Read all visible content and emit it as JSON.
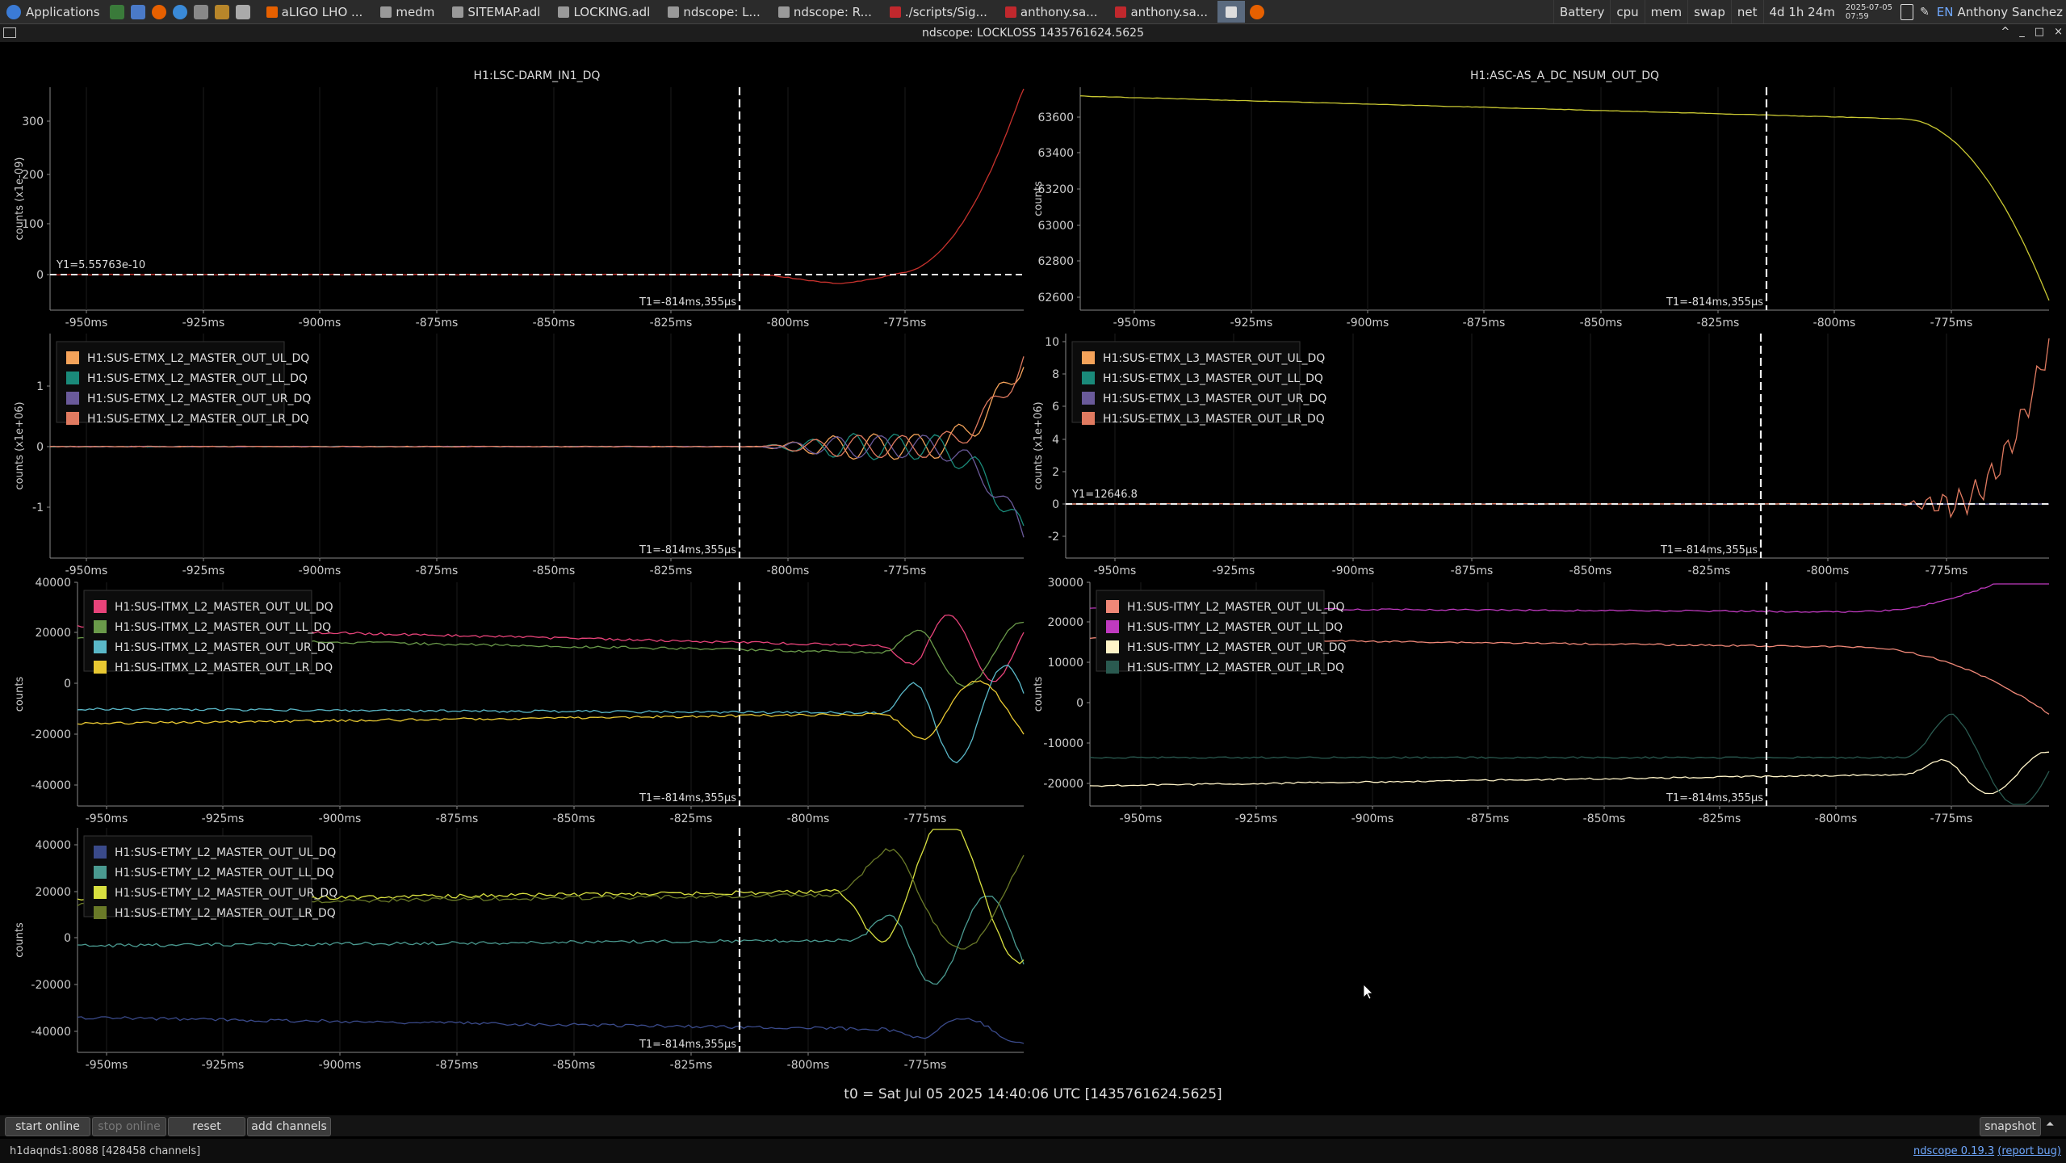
{
  "taskbar": {
    "applications_label": "Applications",
    "tasks": [
      {
        "label": "aLIGO LHO ...",
        "color": "#e66000"
      },
      {
        "label": "medm",
        "color": "#999999"
      },
      {
        "label": "SITEMAP.adl",
        "color": "#999999"
      },
      {
        "label": "LOCKING.adl",
        "color": "#999999"
      },
      {
        "label": "ndscope: L...",
        "color": "#999999"
      },
      {
        "label": "ndscope: R...",
        "color": "#999999"
      },
      {
        "label": "./scripts/Sig...",
        "color": "#c0282d"
      },
      {
        "label": "anthony.sa...",
        "color": "#c0282d"
      },
      {
        "label": "anthony.sa...",
        "color": "#c0282d"
      }
    ],
    "tray": [
      "Battery",
      "cpu",
      "mem",
      "swap",
      "net"
    ],
    "uptime": "4d 1h 24m",
    "date": "2025-07-05",
    "time": "07:59",
    "lang": "EN",
    "user": "Anthony Sanchez"
  },
  "window": {
    "title": "ndscope: LOCKLOSS 1435761624.5625",
    "controls": [
      "^",
      "_",
      "□",
      "×"
    ]
  },
  "plots": [
    {
      "title": "H1:LSC-DARM_IN1_DQ",
      "ylabel": "counts (x1e-09)",
      "yticks": [
        "300",
        "200",
        "100",
        "0"
      ],
      "cursor_y": "Y1=5.55763e-10",
      "cursor_t": "T1=-814ms,355µs",
      "legend": [],
      "colors": [
        "#c8322d"
      ]
    },
    {
      "title": "H1:ASC-AS_A_DC_NSUM_OUT_DQ",
      "ylabel": "counts",
      "yticks": [
        "63600",
        "63400",
        "63200",
        "63000",
        "62800",
        "62600"
      ],
      "cursor_y": "",
      "cursor_t": "T1=-814ms,355µs",
      "legend": [],
      "colors": [
        "#c9c832"
      ]
    },
    {
      "title": "",
      "ylabel": "counts (x1e+06)",
      "yticks": [
        "1",
        "0",
        "-1"
      ],
      "cursor_y": "",
      "cursor_t": "T1=-814ms,355µs",
      "legend": [
        "H1:SUS-ETMX_L2_MASTER_OUT_UL_DQ",
        "H1:SUS-ETMX_L2_MASTER_OUT_LL_DQ",
        "H1:SUS-ETMX_L2_MASTER_OUT_UR_DQ",
        "H1:SUS-ETMX_L2_MASTER_OUT_LR_DQ"
      ],
      "colors": [
        "#f5a35a",
        "#1a8a7a",
        "#6a5a9a",
        "#e07a60"
      ]
    },
    {
      "title": "",
      "ylabel": "counts (x1e+06)",
      "yticks": [
        "10",
        "8",
        "6",
        "4",
        "2",
        "0",
        "-2"
      ],
      "cursor_y": "Y1=12646.8",
      "cursor_t": "T1=-814ms,355µs",
      "legend": [
        "H1:SUS-ETMX_L3_MASTER_OUT_UL_DQ",
        "H1:SUS-ETMX_L3_MASTER_OUT_LL_DQ",
        "H1:SUS-ETMX_L3_MASTER_OUT_UR_DQ",
        "H1:SUS-ETMX_L3_MASTER_OUT_LR_DQ"
      ],
      "colors": [
        "#f5a35a",
        "#1a8a7a",
        "#6a5a9a",
        "#e07a60"
      ]
    },
    {
      "title": "",
      "ylabel": "counts",
      "yticks": [
        "40000",
        "20000",
        "0",
        "-20000",
        "-40000"
      ],
      "cursor_y": "",
      "cursor_t": "T1=-814ms,355µs",
      "legend": [
        "H1:SUS-ITMX_L2_MASTER_OUT_UL_DQ",
        "H1:SUS-ITMX_L2_MASTER_OUT_LL_DQ",
        "H1:SUS-ITMX_L2_MASTER_OUT_UR_DQ",
        "H1:SUS-ITMX_L2_MASTER_OUT_LR_DQ"
      ],
      "colors": [
        "#e8437a",
        "#6a9a4a",
        "#5ab8c8",
        "#e8c832"
      ]
    },
    {
      "title": "",
      "ylabel": "counts",
      "yticks": [
        "30000",
        "20000",
        "10000",
        "0",
        "-10000",
        "-20000"
      ],
      "cursor_y": "",
      "cursor_t": "T1=-814ms,355µs",
      "legend": [
        "H1:SUS-ITMY_L2_MASTER_OUT_UL_DQ",
        "H1:SUS-ITMY_L2_MASTER_OUT_LL_DQ",
        "H1:SUS-ITMY_L2_MASTER_OUT_UR_DQ",
        "H1:SUS-ITMY_L2_MASTER_OUT_LR_DQ"
      ],
      "colors": [
        "#f08878",
        "#c03ac0",
        "#fff4c8",
        "#2a5a50"
      ]
    },
    {
      "title": "",
      "ylabel": "counts",
      "yticks": [
        "40000",
        "20000",
        "0",
        "-20000",
        "-40000"
      ],
      "cursor_y": "",
      "cursor_t": "T1=-814ms,355µs",
      "legend": [
        "H1:SUS-ETMY_L2_MASTER_OUT_UL_DQ",
        "H1:SUS-ETMY_L2_MASTER_OUT_LL_DQ",
        "H1:SUS-ETMY_L2_MASTER_OUT_UR_DQ",
        "H1:SUS-ETMY_L2_MASTER_OUT_LR_DQ"
      ],
      "colors": [
        "#3a4a8a",
        "#4a9a90",
        "#d8e040",
        "#6a7a28"
      ]
    }
  ],
  "xticks": [
    "-950ms",
    "-925ms",
    "-900ms",
    "-875ms",
    "-850ms",
    "-825ms",
    "-800ms",
    "-775ms"
  ],
  "t0_label": "t0 = Sat Jul 05 2025 14:40:06 UTC [1435761624.5625]",
  "buttons": {
    "start_online": "start online",
    "stop_online": "stop online",
    "reset": "reset",
    "add_channels": "add channels",
    "snapshot": "snapshot"
  },
  "status": {
    "server": "h1daqnds1:8088  [428458 channels]",
    "version_prefix": "ndscope ",
    "version": "0.19.3",
    "report": "(report bug)"
  }
}
